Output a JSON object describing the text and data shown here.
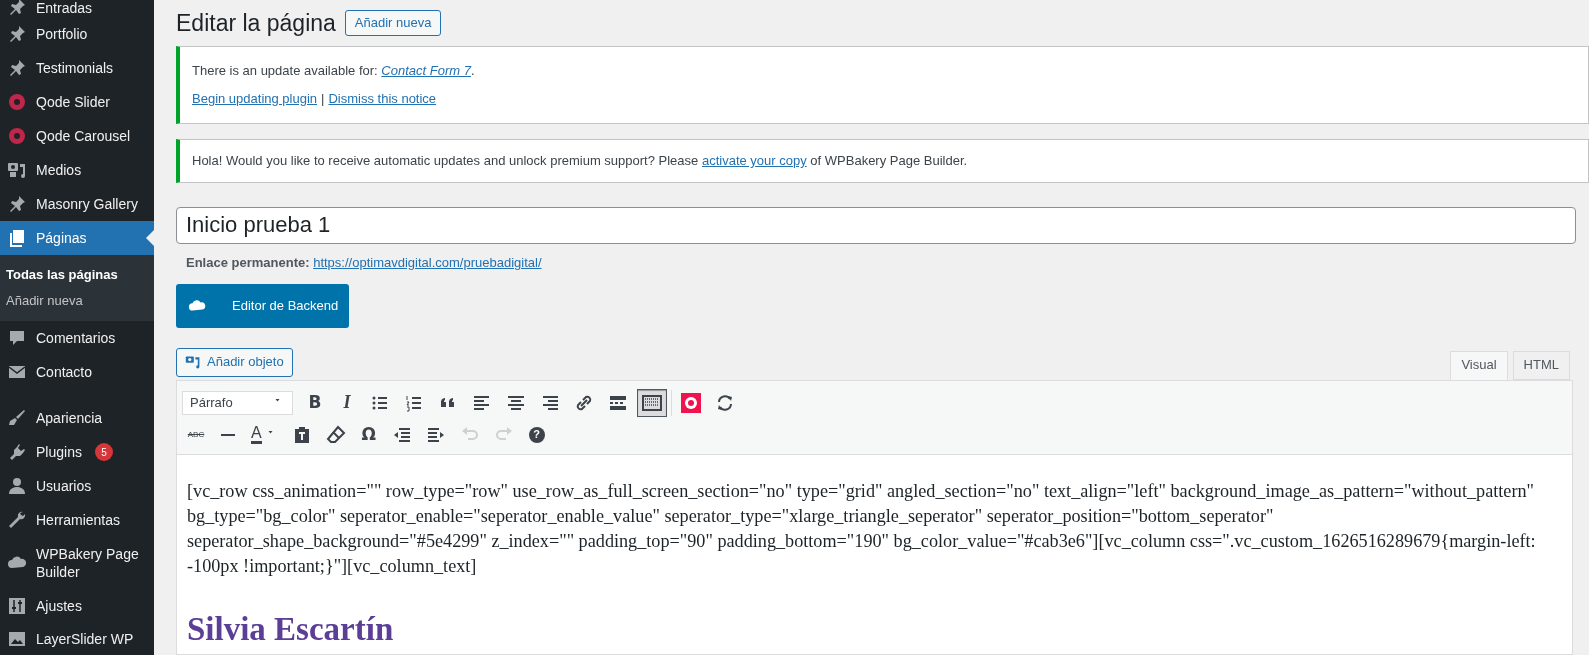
{
  "sidebar": {
    "items": [
      {
        "label": "Entradas",
        "kind": "pin",
        "selected": false
      },
      {
        "label": "Portfolio",
        "kind": "pin",
        "selected": false
      },
      {
        "label": "Testimonials",
        "kind": "pin",
        "selected": false
      },
      {
        "label": "Qode Slider",
        "kind": "ring",
        "selected": false
      },
      {
        "label": "Qode Carousel",
        "kind": "ring",
        "selected": false
      },
      {
        "label": "Medios",
        "kind": "media",
        "selected": false
      },
      {
        "label": "Masonry Gallery",
        "kind": "pin",
        "selected": false
      },
      {
        "label": "Páginas",
        "kind": "pages",
        "selected": true,
        "children": [
          {
            "label": "Todas las páginas",
            "selected": true
          },
          {
            "label": "Añadir nueva",
            "selected": false
          }
        ]
      },
      {
        "label": "Comentarios",
        "kind": "comment",
        "selected": false
      },
      {
        "label": "Contacto",
        "kind": "mail",
        "selected": false
      },
      {
        "label": "Apariencia",
        "kind": "brush",
        "selected": false,
        "gap_before": true
      },
      {
        "label": "Plugins",
        "kind": "plug",
        "selected": false,
        "badge": "5"
      },
      {
        "label": "Usuarios",
        "kind": "user",
        "selected": false
      },
      {
        "label": "Herramientas",
        "kind": "wrench",
        "selected": false
      },
      {
        "label": "WPBakery Page Builder",
        "kind": "cloud",
        "selected": false
      },
      {
        "label": "Ajustes",
        "kind": "sliders",
        "selected": false
      },
      {
        "label": "LayerSlider WP",
        "kind": "layers",
        "selected": false
      }
    ]
  },
  "header": {
    "title": "Editar la página",
    "add_button": "Añadir nueva"
  },
  "notices": [
    {
      "text_before": "There is an update available for: ",
      "link": "Contact Form 7",
      "link_italic": true,
      "text_after": ".",
      "actions": [
        "Begin updating plugin",
        "Dismiss this notice"
      ],
      "separator": "|"
    },
    {
      "text_before": "Hola! Would you like to receive automatic updates and unlock premium support? Please ",
      "link": "activate your copy",
      "link_italic": false,
      "text_after": " of WPBakery Page Builder."
    }
  ],
  "title_field": {
    "value": "Inicio prueba 1"
  },
  "permalink": {
    "label": "Enlace permanente: ",
    "url": "https://optimavdigital.com/pruebadigital/"
  },
  "backend_button": "Editor de Backend",
  "add_media_button": "Añadir objeto",
  "tabs": [
    {
      "label": "Visual",
      "selected": true
    },
    {
      "label": "HTML",
      "selected": false
    }
  ],
  "toolbar": {
    "rows": [
      [
        {
          "kind": "dropdown",
          "value": "Párrafo"
        },
        {
          "kind": "bold",
          "glyph": "B",
          "pressed": false,
          "disabled": false
        },
        {
          "kind": "italic",
          "glyph": "I",
          "pressed": false,
          "disabled": false
        },
        {
          "kind": "bullets",
          "pressed": false,
          "disabled": false
        },
        {
          "kind": "numbers",
          "pressed": false,
          "disabled": false
        },
        {
          "kind": "quote",
          "pressed": false,
          "disabled": false
        },
        {
          "kind": "align_left",
          "pressed": false,
          "disabled": false
        },
        {
          "kind": "align_center",
          "pressed": false,
          "disabled": false
        },
        {
          "kind": "align_right",
          "pressed": false,
          "disabled": false
        },
        {
          "kind": "link",
          "pressed": false,
          "disabled": false
        },
        {
          "kind": "more",
          "pressed": false,
          "disabled": false
        },
        {
          "kind": "toggle",
          "pressed": true,
          "disabled": false
        },
        {
          "kind": "plugin",
          "pressed": false,
          "disabled": false
        },
        {
          "kind": "refresh",
          "pressed": false,
          "disabled": false
        }
      ],
      [
        {
          "kind": "strike",
          "glyph": "ABC",
          "pressed": false,
          "disabled": false
        },
        {
          "kind": "hr",
          "pressed": false,
          "disabled": false
        },
        {
          "kind": "color",
          "glyph": "A",
          "pressed": false,
          "disabled": false
        },
        {
          "kind": "paste",
          "pressed": false,
          "disabled": false
        },
        {
          "kind": "eraser",
          "pressed": false,
          "disabled": false
        },
        {
          "kind": "charmap",
          "glyph": "Ω",
          "pressed": false,
          "disabled": false
        },
        {
          "kind": "outdent",
          "pressed": false,
          "disabled": false
        },
        {
          "kind": "indent",
          "pressed": false,
          "disabled": false
        },
        {
          "kind": "undo",
          "pressed": false,
          "disabled": true
        },
        {
          "kind": "redo",
          "pressed": false,
          "disabled": true
        },
        {
          "kind": "help",
          "glyph": "?",
          "pressed": false,
          "disabled": false
        }
      ]
    ]
  },
  "content": {
    "shortcode": "[vc_row css_animation=\"\" row_type=\"row\" use_row_as_full_screen_section=\"no\" type=\"grid\" angled_section=\"no\" text_align=\"left\" background_image_as_pattern=\"without_pattern\" bg_type=\"bg_color\" seperator_enable=\"seperator_enable_value\" seperator_type=\"xlarge_triangle_seperator\" seperator_position=\"bottom_seperator\" seperator_shape_background=\"#5e4299\" z_index=\"\" padding_top=\"90\" padding_bottom=\"190\" bg_color_value=\"#cab3e6\"][vc_column css=\".vc_custom_1626516289679{margin-left: -100px !important;}\"][vc_column_text]",
    "heading": "Silvia Escartín"
  }
}
